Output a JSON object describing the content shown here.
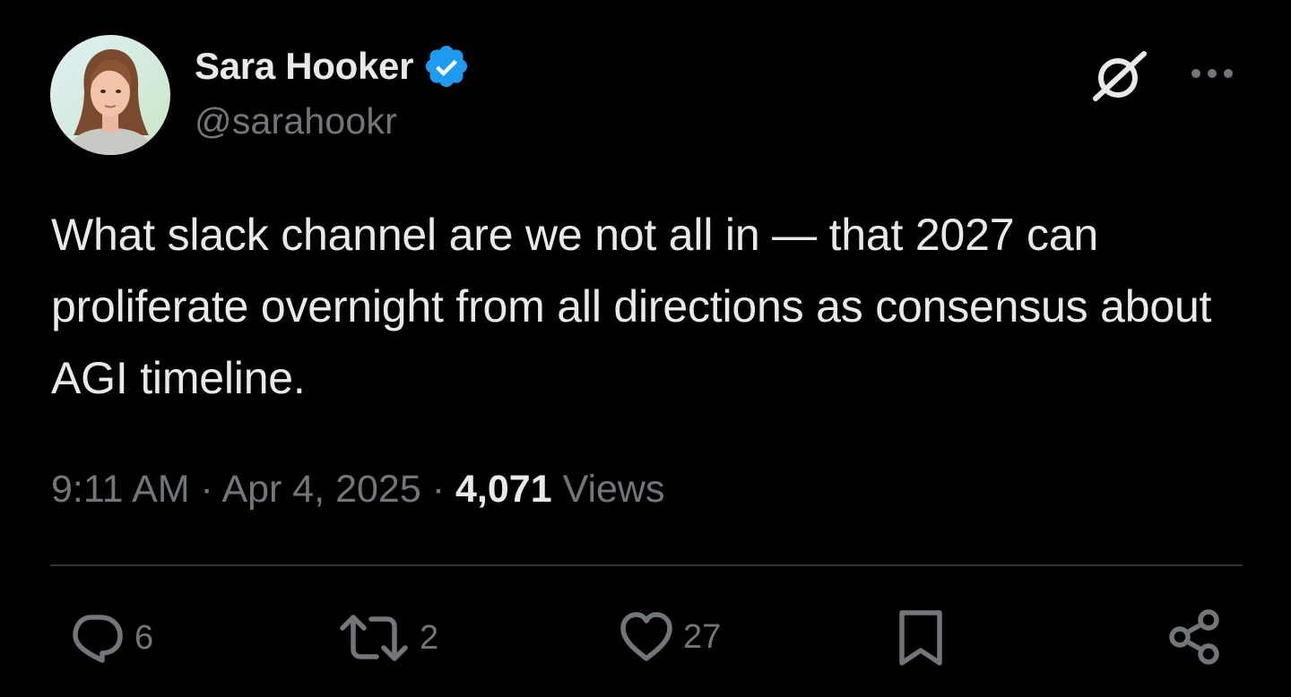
{
  "author": {
    "display_name": "Sara Hooker",
    "handle": "@sarahookr",
    "verified": true
  },
  "header_icons": {
    "grok": "grok-slash-icon",
    "more": "more-options-icon"
  },
  "tweet": {
    "text": "What slack channel are we not all in — that 2027 can proliferate overnight from all directions as consensus about AGI timeline.",
    "time": "9:11 AM",
    "date": "Apr 4, 2025",
    "separator": "·",
    "views_count": "4,071",
    "views_label": "Views"
  },
  "actions": {
    "reply": {
      "icon": "reply-icon",
      "count": "6"
    },
    "retweet": {
      "icon": "retweet-icon",
      "count": "2"
    },
    "like": {
      "icon": "heart-icon",
      "count": "27"
    },
    "bookmark": {
      "icon": "bookmark-icon"
    },
    "share": {
      "icon": "share-icon"
    }
  },
  "colors": {
    "background": "#000000",
    "primary_text": "#e7e9ea",
    "secondary_text": "#71767b",
    "verified_blue": "#1d9bf0",
    "divider": "#2f3336"
  }
}
